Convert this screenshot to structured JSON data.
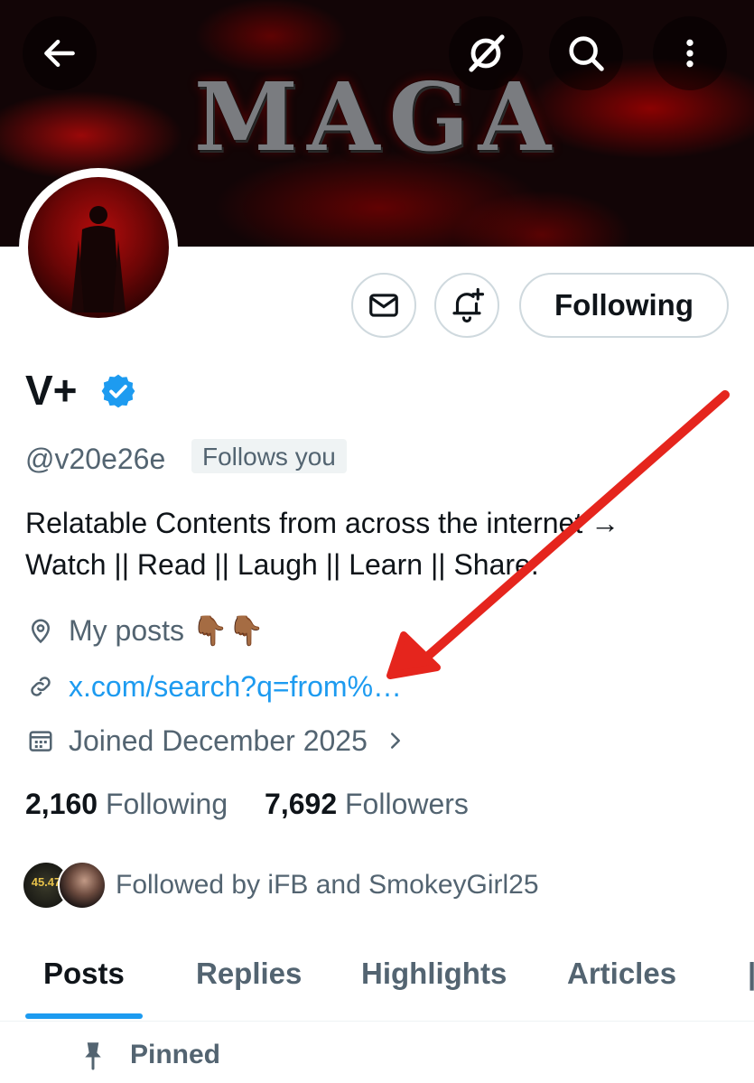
{
  "banner": {
    "title": "MAGA"
  },
  "header_actions": {
    "back": "back-arrow-icon",
    "grok": "grok-icon",
    "search": "search-icon",
    "more": "more-vertical-icon"
  },
  "profile": {
    "name": "V+",
    "handle": "@v20e26e",
    "follows_you_badge": "Follows you",
    "bio_line1": "Relatable Contents from across the internet →",
    "bio_line2": "Watch || Read || Laugh || Learn || Share.",
    "location": "My posts 👇🏾👇🏾",
    "website": "x.com/search?q=from%…",
    "joined": "Joined December 2025",
    "following_count": "2,160",
    "following_label": "Following",
    "followers_count": "7,692",
    "followers_label": "Followers",
    "followed_by": "Followed by iFB and SmokeyGirl25",
    "mini_avatar_text": "45.47"
  },
  "actions": {
    "message": "message-icon",
    "notify": "bell-plus-icon",
    "following_button": "Following"
  },
  "tabs": [
    {
      "label": "Posts",
      "active": true
    },
    {
      "label": "Replies",
      "active": false
    },
    {
      "label": "Highlights",
      "active": false
    },
    {
      "label": "Articles",
      "active": false
    }
  ],
  "pinned_label": "Pinned",
  "colors": {
    "accent": "#1d9bf0",
    "annotation_arrow": "#e5251d",
    "secondary_text": "#536471"
  }
}
